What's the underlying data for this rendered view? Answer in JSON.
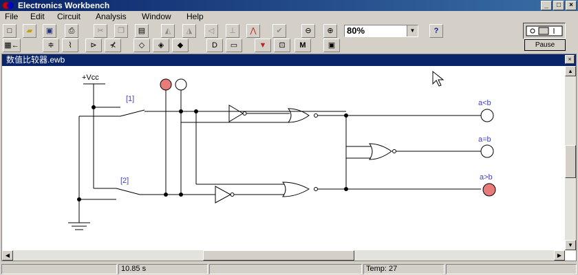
{
  "window": {
    "title": "Electronics Workbench",
    "minimize_icon": "_",
    "maximize_icon": "□",
    "close_icon": "×"
  },
  "menu": [
    "File",
    "Edit",
    "Circuit",
    "Analysis",
    "Window",
    "Help"
  ],
  "toolbar": {
    "zoom_value": "80%",
    "help_label": "?",
    "M_label": "M"
  },
  "pause_button": "Pause",
  "document": {
    "title": "数值比较器.ewb",
    "close_icon": "×"
  },
  "circuit": {
    "vcc_label": "+Vcc",
    "switch1_label": "[1]",
    "switch2_label": "[2]",
    "out_lt_label": "a<b",
    "out_eq_label": "a=b",
    "out_gt_label": "a>b",
    "colors": {
      "wire": "#000000",
      "label_blue": "#4040c0",
      "led_on": "#e87a7a",
      "led_off": "#ffffff"
    }
  },
  "status": {
    "time": "10.85 s",
    "temp": "Temp:  27"
  }
}
